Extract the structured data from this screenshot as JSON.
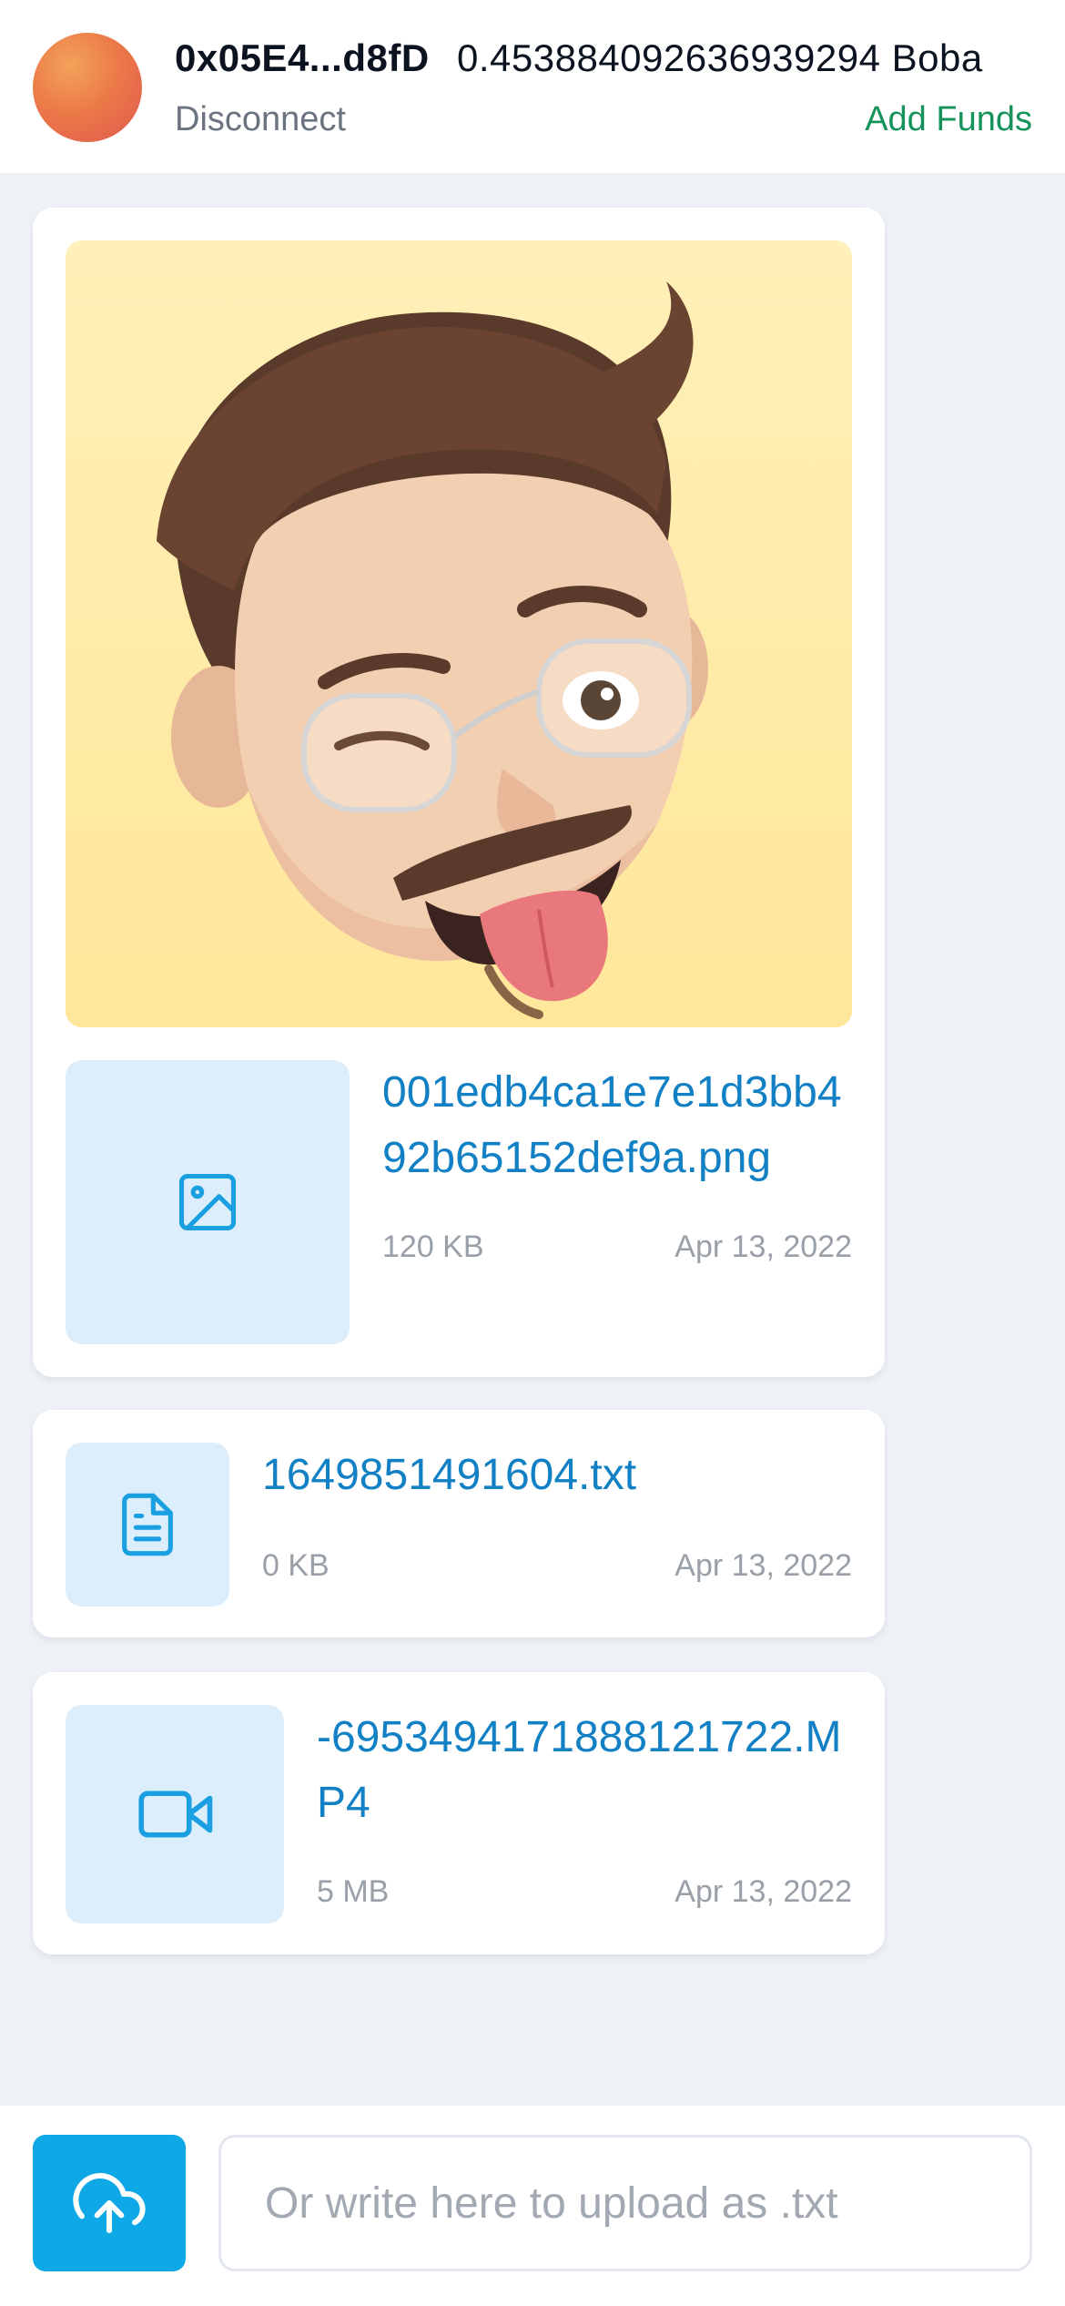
{
  "header": {
    "address": "0x05E4...d8fD",
    "balance": "0.45388409263693929​4 Boba",
    "disconnect_label": "Disconnect",
    "add_funds_label": "Add Funds"
  },
  "files": [
    {
      "name": "001edb4ca1e7e1d3bb492b65152def9a.png",
      "size": "120 KB",
      "date": "Apr 13, 2022",
      "icon": "image-icon",
      "has_preview": true
    },
    {
      "name": "1649851491604.txt",
      "size": "0 KB",
      "date": "Apr 13, 2022",
      "icon": "document-icon"
    },
    {
      "name": "-6953494171888121722.MP4",
      "size": "5 MB",
      "date": "Apr 13, 2022",
      "icon": "video-icon"
    }
  ],
  "footer": {
    "upload_icon": "cloud-upload-icon",
    "input_placeholder": "Or write here to upload as .txt",
    "input_value": ""
  },
  "colors": {
    "accent": "#0fa8e6",
    "link": "#1280c4",
    "add_funds": "#15935a",
    "thumb_bg": "#dceefc",
    "page_bg": "#eef2f7"
  }
}
